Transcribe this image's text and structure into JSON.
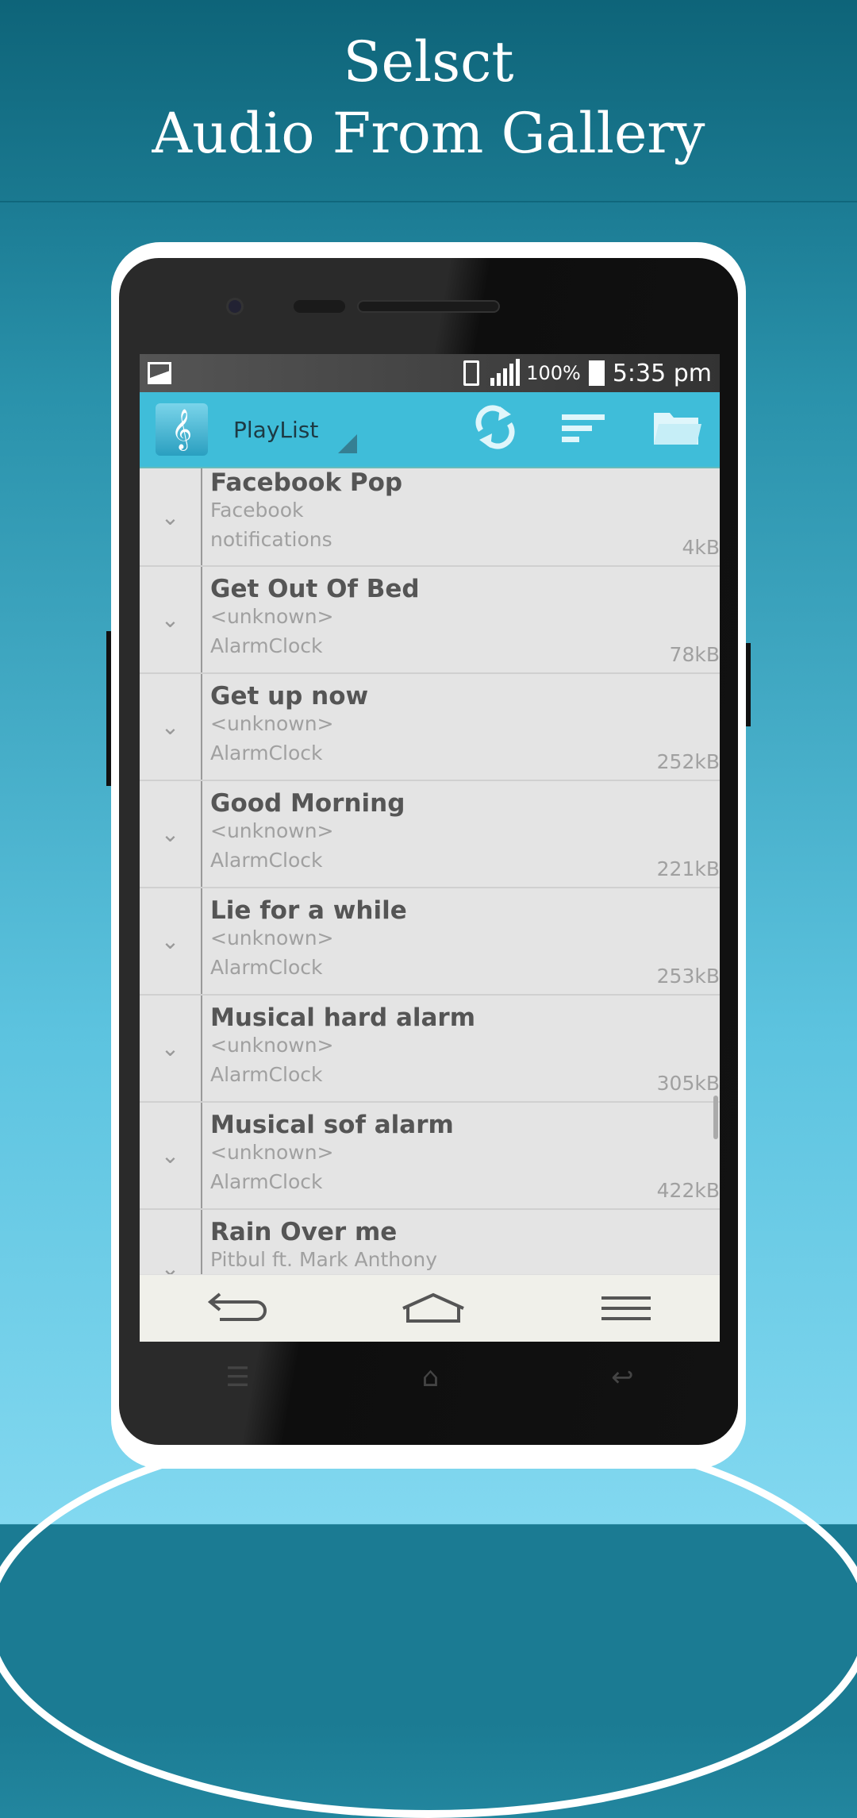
{
  "promo": {
    "line1": "Selsct",
    "line2": "Audio From Gallery"
  },
  "status": {
    "battery": "100%",
    "time": "5:35 pm",
    "icons": [
      "image-icon",
      "vibrate-icon",
      "signal-icon",
      "battery-icon"
    ]
  },
  "appbar": {
    "title": "PlayList",
    "actions": [
      "refresh-icon",
      "sort-icon",
      "folder-icon"
    ]
  },
  "songs": [
    {
      "title": "Facebook Pop",
      "artist": "Facebook",
      "album": "notifications",
      "size": "4kB"
    },
    {
      "title": "Get Out Of Bed",
      "artist": "<unknown>",
      "album": "AlarmClock",
      "size": "78kB"
    },
    {
      "title": "Get up now",
      "artist": "<unknown>",
      "album": "AlarmClock",
      "size": "252kB"
    },
    {
      "title": "Good Morning",
      "artist": "<unknown>",
      "album": "AlarmClock",
      "size": "221kB"
    },
    {
      "title": "Lie for a while",
      "artist": "<unknown>",
      "album": "AlarmClock",
      "size": "253kB"
    },
    {
      "title": "Musical hard alarm",
      "artist": "<unknown>",
      "album": "AlarmClock",
      "size": "305kB"
    },
    {
      "title": "Musical sof alarm",
      "artist": "<unknown>",
      "album": "AlarmClock",
      "size": "422kB"
    },
    {
      "title": "Rain Over me",
      "artist": "Pitbul ft. Mark Anthony"
    }
  ],
  "colors": {
    "appbar": "#3fbdd9",
    "header": "#0e6479"
  }
}
